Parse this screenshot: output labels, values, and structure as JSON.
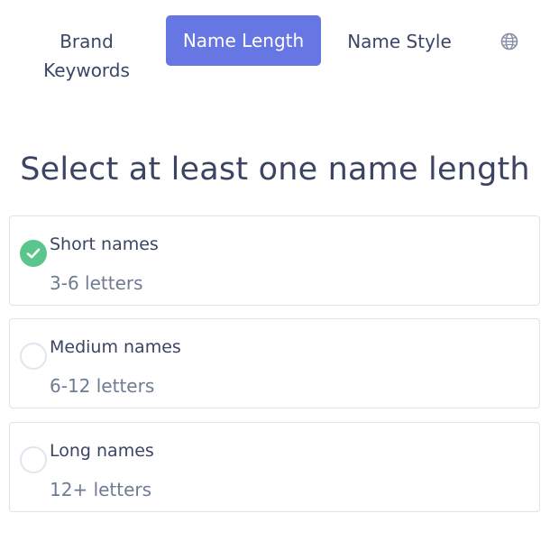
{
  "nav": {
    "tabs": [
      {
        "label_line1": "Brand",
        "label_line2": "Keywords",
        "active": false
      },
      {
        "label": "Name Length",
        "active": true
      },
      {
        "label": "Name Style",
        "active": false
      }
    ],
    "language_icon": "globe-icon",
    "active_color": "#6676e3"
  },
  "main": {
    "title": "Select at least one name length",
    "options": [
      {
        "title": "Short names",
        "subtitle": "3-6 letters",
        "checked": true
      },
      {
        "title": "Medium names",
        "subtitle": "6-12 letters",
        "checked": false
      },
      {
        "title": "Long names",
        "subtitle": "12+ letters",
        "checked": false
      }
    ],
    "check_color": "#5ac58c"
  }
}
